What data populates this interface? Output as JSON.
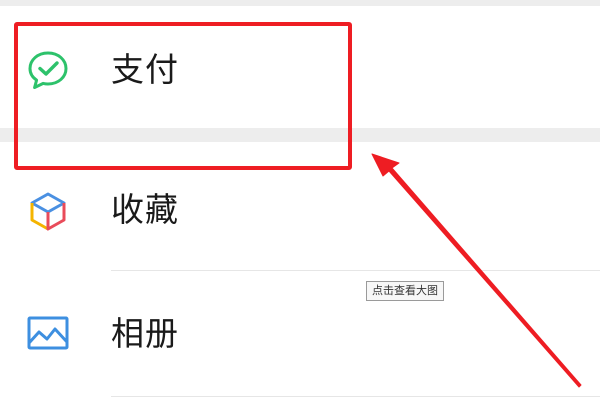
{
  "menu": {
    "items": [
      {
        "label": "支付",
        "icon": "wechat-pay-icon"
      },
      {
        "label": "收藏",
        "icon": "favorites-cube-icon"
      },
      {
        "label": "相册",
        "icon": "album-picture-icon"
      }
    ]
  },
  "overlay": {
    "tooltip": "点击查看大图",
    "highlight_color": "#ee1d23"
  },
  "colors": {
    "pay_green": "#2dc26b",
    "separator": "#ededed",
    "album_blue": "#3d8fe0"
  }
}
